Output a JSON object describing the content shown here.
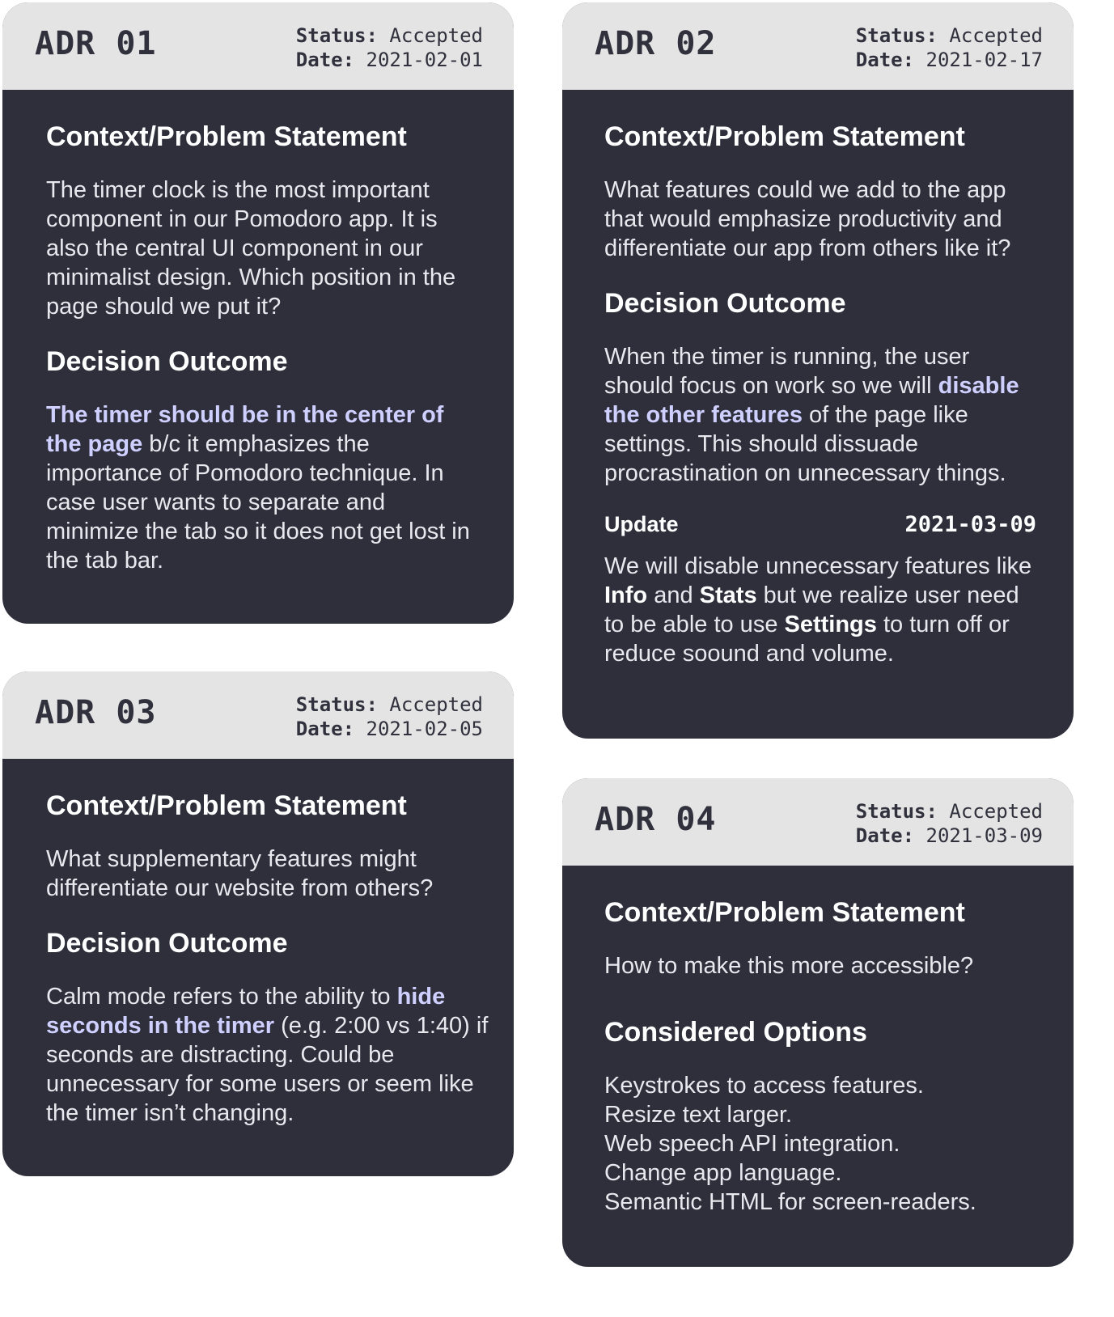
{
  "cards": [
    {
      "id": "ADR 01",
      "status_label": "Status:",
      "status": "Accepted",
      "date_label": "Date:",
      "date": "2021-02-01",
      "context_heading": "Context/Problem Statement",
      "context": "The timer clock is the most important component in our Pomodoro app. It is also the central UI component in our minimalist design. Which position in the page should we put it?",
      "decision_heading": "Decision Outcome",
      "decision_hl": "The timer should be in the center of the page",
      "decision_rest": " b/c it emphasizes the importance of Pomodoro technique. In case user wants to separate and minimize the tab so it does not get lost in the tab bar."
    },
    {
      "id": "ADR 02",
      "status_label": "Status:",
      "status": "Accepted",
      "date_label": "Date:",
      "date": "2021-02-17",
      "context_heading": "Context/Problem Statement",
      "context": "What features could we add to the app that would emphasize productivity and differentiate our app from others like it?",
      "decision_heading": "Decision Outcome",
      "decision_pre": "When the timer is running, the user should focus on work so we will ",
      "decision_hl": "disable the other features",
      "decision_post": " of the page like settings. This should dissuade procrastination on unnecessary things.",
      "update_label": "Update",
      "update_date": "2021-03-09",
      "update_pre": "We will disable unnecessary features like ",
      "update_b1": "Info",
      "update_mid1": " and ",
      "update_b2": "Stats",
      "update_mid2": " but we realize user need to be able to use ",
      "update_b3": "Settings",
      "update_post": " to turn off or reduce soound and volume."
    },
    {
      "id": "ADR 03",
      "status_label": "Status:",
      "status": "Accepted",
      "date_label": "Date:",
      "date": "2021-02-05",
      "context_heading": "Context/Problem Statement",
      "context": "What supplementary features might differentiate our website from others?",
      "decision_heading": "Decision Outcome",
      "decision_pre": "Calm mode refers to the ability to ",
      "decision_hl": "hide seconds in the timer",
      "decision_post": " (e.g. 2:00 vs 1:40) if seconds are distracting. Could be unnecessary for some users or seem like the timer isn’t changing."
    },
    {
      "id": "ADR 04",
      "status_label": "Status:",
      "status": "Accepted",
      "date_label": "Date:",
      "date": "2021-03-09",
      "context_heading": "Context/Problem Statement",
      "context": "How to make this more accessible?",
      "options_heading": "Considered Options",
      "options": [
        "Keystrokes to access features.",
        "Resize text larger.",
        "Web speech API integration.",
        "Change app language.",
        "Semantic HTML for screen-readers."
      ]
    }
  ]
}
